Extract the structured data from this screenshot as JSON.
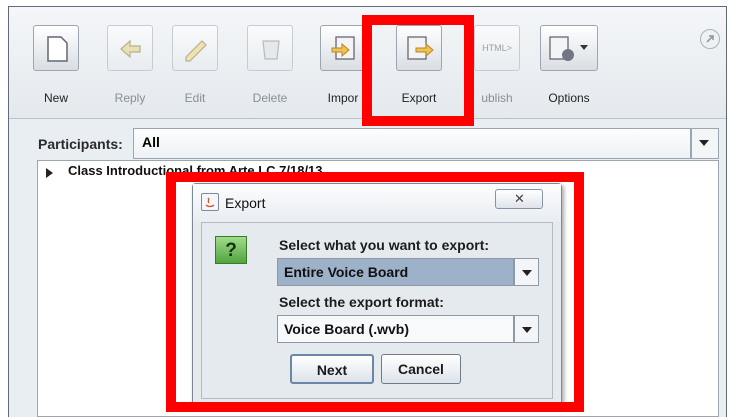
{
  "toolbar": {
    "buttons": [
      {
        "label": "New",
        "icon": "new-document-icon",
        "enabled": true
      },
      {
        "label": "Reply",
        "icon": "reply-icon",
        "enabled": false
      },
      {
        "label": "Edit",
        "icon": "edit-icon",
        "enabled": false
      },
      {
        "label": "Delete",
        "icon": "delete-icon",
        "enabled": false
      },
      {
        "label": "Impor",
        "icon": "import-icon",
        "enabled": true
      },
      {
        "label": "Export",
        "icon": "export-icon",
        "enabled": true
      },
      {
        "label": "ublish",
        "icon": "html-publish-icon",
        "enabled": false
      },
      {
        "label": "Options",
        "icon": "options-gear-icon",
        "enabled": true
      }
    ],
    "publish_icon_text": "HTML>"
  },
  "participants": {
    "label": "Participants:",
    "selected": "All"
  },
  "message_list": {
    "rows": [
      {
        "text": "Class Introductional from Arte LC 7/18/13"
      }
    ]
  },
  "export_dialog": {
    "title": "Export",
    "close_glyph": "✕",
    "question_glyph": "?",
    "scope_prompt": "Select what you want to export:",
    "scope_selected": "Entire Voice Board",
    "format_prompt": "Select the export format:",
    "format_selected": "Voice Board (.wvb)",
    "next_label": "Next",
    "cancel_label": "Cancel"
  },
  "colors": {
    "highlight": "#ff0000",
    "selected_field": "#9db1c8",
    "question_icon": "#53a340"
  }
}
